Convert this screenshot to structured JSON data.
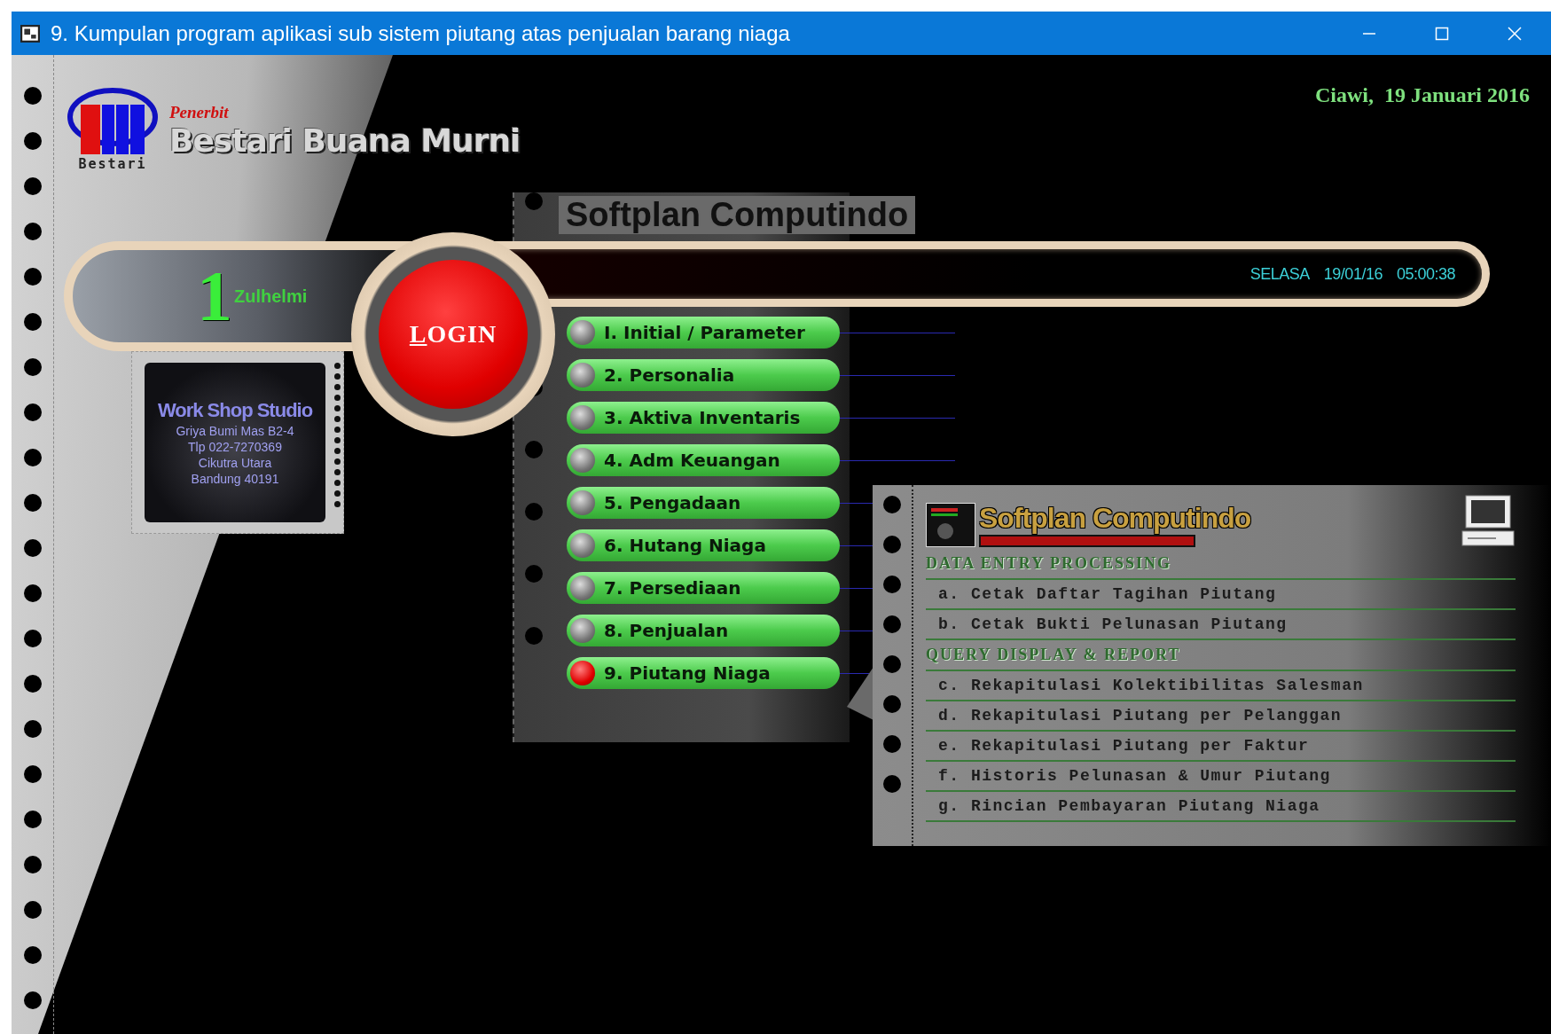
{
  "window": {
    "title": "9. Kumpulan program aplikasi sub sistem piutang atas penjualan barang niaga"
  },
  "publisher": {
    "label": "Penerbit",
    "name": "Bestari Buana Murni",
    "logo_caption": "Bestari"
  },
  "location_date": "Ciawi,  19 Januari 2016",
  "user": {
    "number": "1",
    "name": "Zulhelmi"
  },
  "login_button": {
    "label": "LOGIN"
  },
  "clock": {
    "day": "SELASA",
    "date": "19/01/16",
    "time": "05:00:38"
  },
  "studio_card": {
    "name": "Work Shop Studio",
    "lines": [
      "Griya Bumi Mas B2-4",
      "Tlp 022-7270369",
      "Cikutra Utara",
      "Bandung 40191"
    ]
  },
  "menu": {
    "heading": "Softplan Computindo",
    "items": [
      {
        "label": "I. Initial / Parameter",
        "selected": false
      },
      {
        "label": "2. Personalia",
        "selected": false
      },
      {
        "label": "3. Aktiva Inventaris",
        "selected": false
      },
      {
        "label": "4. Adm Keuangan",
        "selected": false
      },
      {
        "label": "5. Pengadaan",
        "selected": false
      },
      {
        "label": "6. Hutang Niaga",
        "selected": false
      },
      {
        "label": "7. Persediaan",
        "selected": false
      },
      {
        "label": "8. Penjualan",
        "selected": false
      },
      {
        "label": "9. Piutang Niaga",
        "selected": true
      }
    ]
  },
  "submenu": {
    "brand": "Softplan Computindo",
    "sections": [
      {
        "title": "DATA ENTRY PROCESSING",
        "items": [
          "a. Cetak Daftar Tagihan Piutang",
          "b. Cetak Bukti Pelunasan Piutang"
        ]
      },
      {
        "title": "QUERY DISPLAY & REPORT",
        "items": [
          "c. Rekapitulasi Kolektibilitas Salesman",
          "d. Rekapitulasi Piutang per Pelanggan",
          "e. Rekapitulasi Piutang per Faktur",
          "f. Historis Pelunasan & Umur Piutang",
          "g. Rincian Pembayaran Piutang Niaga"
        ]
      }
    ]
  }
}
